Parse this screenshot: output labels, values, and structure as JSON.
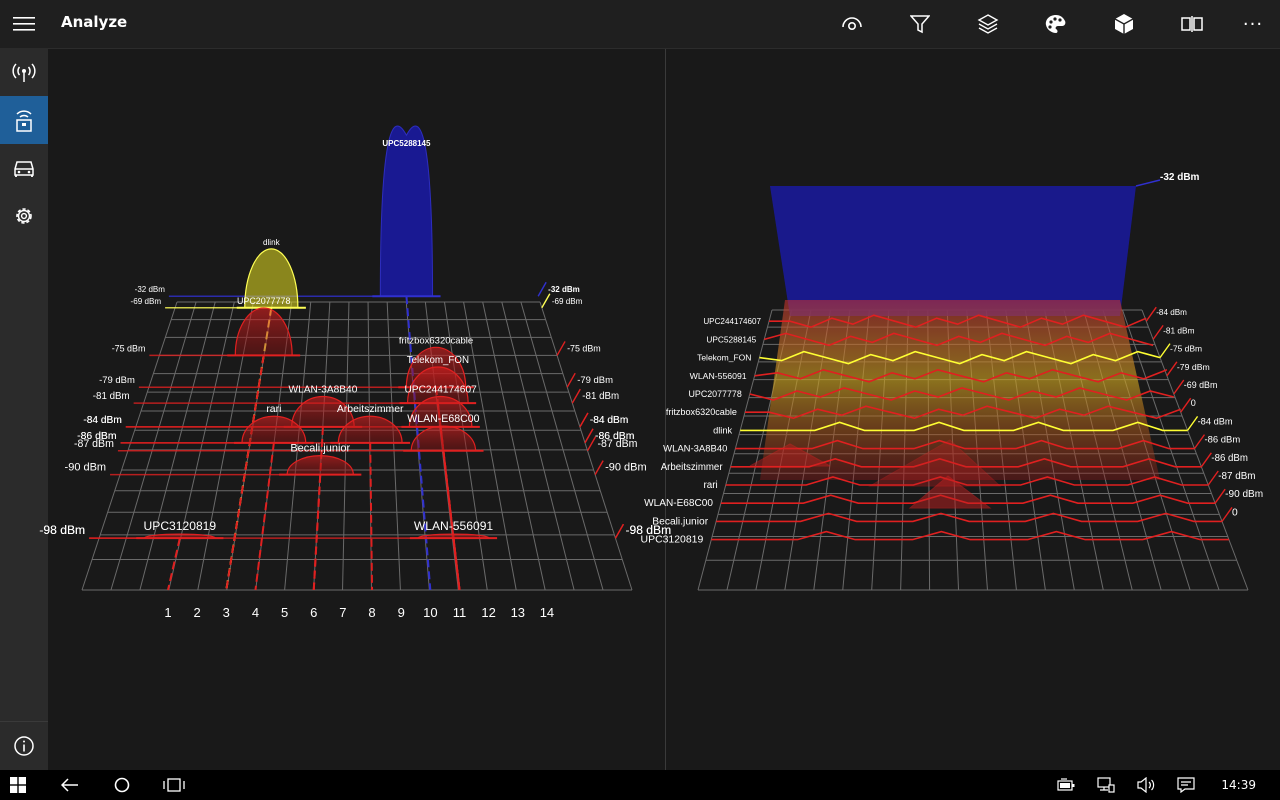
{
  "app": {
    "title": "Analyze"
  },
  "toolbar": {
    "buttons": [
      {
        "name": "view-icon"
      },
      {
        "name": "filter-icon"
      },
      {
        "name": "layers-icon"
      },
      {
        "name": "palette-icon"
      },
      {
        "name": "cube-icon"
      },
      {
        "name": "compare-icon"
      },
      {
        "name": "more-icon",
        "label": "···"
      }
    ]
  },
  "sidebar": {
    "items": [
      {
        "name": "signal-antenna-icon",
        "active": false
      },
      {
        "name": "wifi-device-icon",
        "active": true
      },
      {
        "name": "car-icon",
        "active": false
      },
      {
        "name": "settings-gear-icon",
        "active": false
      }
    ],
    "info": "info-icon"
  },
  "colors": {
    "accent": "#1f5f99",
    "selected": "#ffff33",
    "highlight": "#1a1aa0",
    "network": "#e02020"
  },
  "chart_data": [
    {
      "type": "area",
      "chart": "channel-graph-3d",
      "xlabels": [
        "1",
        "2",
        "3",
        "4",
        "5",
        "6",
        "7",
        "8",
        "9",
        "10",
        "11",
        "12",
        "13",
        "14"
      ],
      "networks": [
        {
          "ssid": "UPC5288145",
          "channel": 10,
          "dbm": -32,
          "dbm_label": "-32 dBm",
          "color": "#1a1aa0"
        },
        {
          "ssid": "dlink",
          "channel": 3,
          "dbm": -69,
          "dbm_label": "-69 dBm",
          "color": "#ffff33"
        },
        {
          "ssid": "UPC2077778",
          "channel": 3,
          "dbm": -75,
          "dbm_label": "-75 dBm",
          "color": "#e02020"
        },
        {
          "ssid": "fritzbox6320cable",
          "channel": 11,
          "dbm": -79,
          "dbm_label": "-79 dBm",
          "color": "#e02020"
        },
        {
          "ssid": "Telekom_FON",
          "channel": 11,
          "dbm": -81,
          "dbm_label": "-81 dBm",
          "color": "#e02020"
        },
        {
          "ssid": "WLAN-3A8B40",
          "channel": 6,
          "dbm": -84,
          "dbm_label": "-84 dBm",
          "color": "#e02020"
        },
        {
          "ssid": "UPC244174607",
          "channel": 11,
          "dbm": -84,
          "dbm_label": "-84 dBm",
          "color": "#e02020"
        },
        {
          "ssid": "rari",
          "channel": 4,
          "dbm": -86,
          "dbm_label": "-86 dBm",
          "color": "#e02020"
        },
        {
          "ssid": "Arbeitszimmer",
          "channel": 8,
          "dbm": -86,
          "dbm_label": "-86 dBm",
          "color": "#e02020"
        },
        {
          "ssid": "WLAN-E68C00",
          "channel": 11,
          "dbm": -87,
          "dbm_label": "-87 dBm",
          "color": "#e02020"
        },
        {
          "ssid": "Becali.junior",
          "channel": 6,
          "dbm": -90,
          "dbm_label": "-90 dBm",
          "color": "#e02020"
        },
        {
          "ssid": "UPC3120819",
          "channel": 1,
          "dbm": -98,
          "dbm_label": "-98 dBm",
          "color": "#e02020"
        },
        {
          "ssid": "WLAN-556091",
          "channel": 11,
          "dbm": -98,
          "dbm_label": "-98 dBm",
          "color": "#e02020"
        }
      ]
    },
    {
      "type": "area",
      "chart": "time-graph-3d",
      "networks": [
        {
          "ssid": "UPC244174607",
          "dbm_label": "-84 dBm"
        },
        {
          "ssid": "UPC5288145",
          "dbm_label": "-81 dBm"
        },
        {
          "ssid": "Telekom_FON",
          "dbm_label": "-75 dBm"
        },
        {
          "ssid": "WLAN-556091",
          "dbm_label": "-79 dBm"
        },
        {
          "ssid": "UPC2077778",
          "dbm_label": "-69 dBm"
        },
        {
          "ssid": "fritzbox6320cable",
          "dbm_label": "0"
        },
        {
          "ssid": "dlink",
          "dbm_label": "-84 dBm"
        },
        {
          "ssid": "WLAN-3A8B40",
          "dbm_label": "-86 dBm"
        },
        {
          "ssid": "Arbeitszimmer",
          "dbm_label": "-86 dBm"
        },
        {
          "ssid": "rari",
          "dbm_label": "-87 dBm"
        },
        {
          "ssid": "WLAN-E68C00",
          "dbm_label": "-90 dBm"
        },
        {
          "ssid": "Becali.junior",
          "dbm_label": "0"
        },
        {
          "ssid": "UPC3120819",
          "dbm_label": ""
        }
      ],
      "top_label": "-32 dBm"
    }
  ],
  "taskbar": {
    "items": [
      "windows-start-icon",
      "back-arrow-icon",
      "cortana-circle-icon",
      "task-view-icon"
    ],
    "tray": [
      "battery-icon",
      "network-icon",
      "volume-icon",
      "action-center-icon"
    ],
    "clock": "14:39"
  }
}
